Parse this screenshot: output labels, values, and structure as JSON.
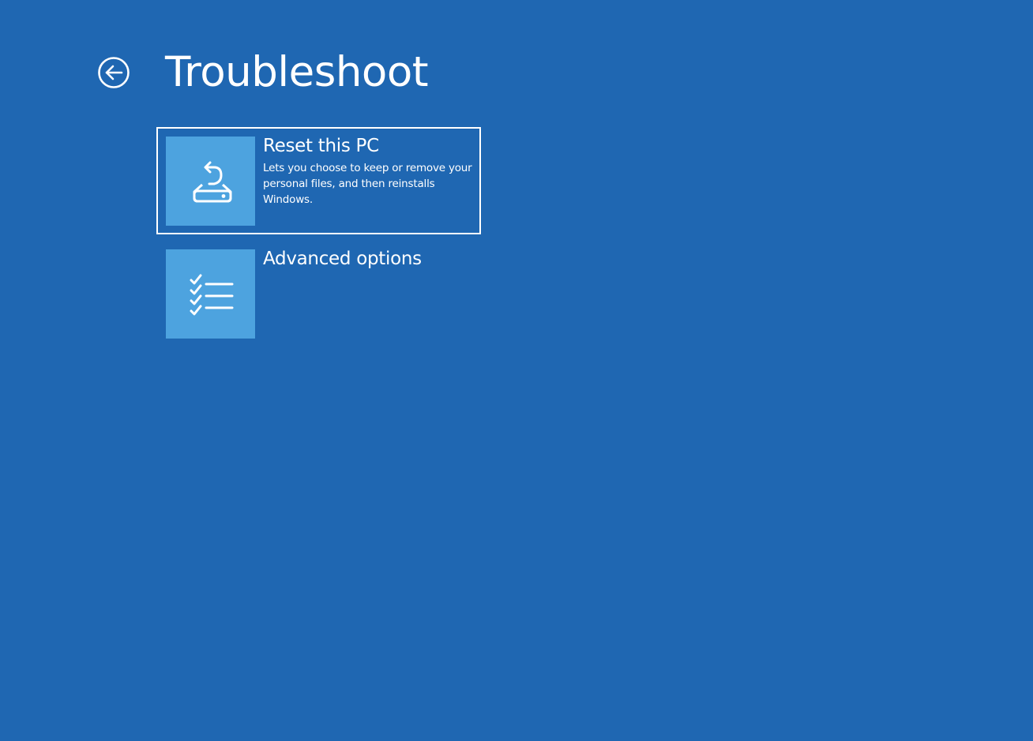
{
  "page": {
    "title": "Troubleshoot",
    "background_color": "#1f67b2",
    "tile_color": "#4da3df",
    "text_color": "#ffffff"
  },
  "navigation": {
    "back_icon": "back-arrow-icon"
  },
  "options": [
    {
      "title": "Reset this PC",
      "description": "Lets you choose to keep or remove your personal files, and then reinstalls Windows.",
      "icon": "reset-pc-icon",
      "selected": true
    },
    {
      "title": "Advanced options",
      "description": "",
      "icon": "checklist-icon",
      "selected": false
    }
  ]
}
